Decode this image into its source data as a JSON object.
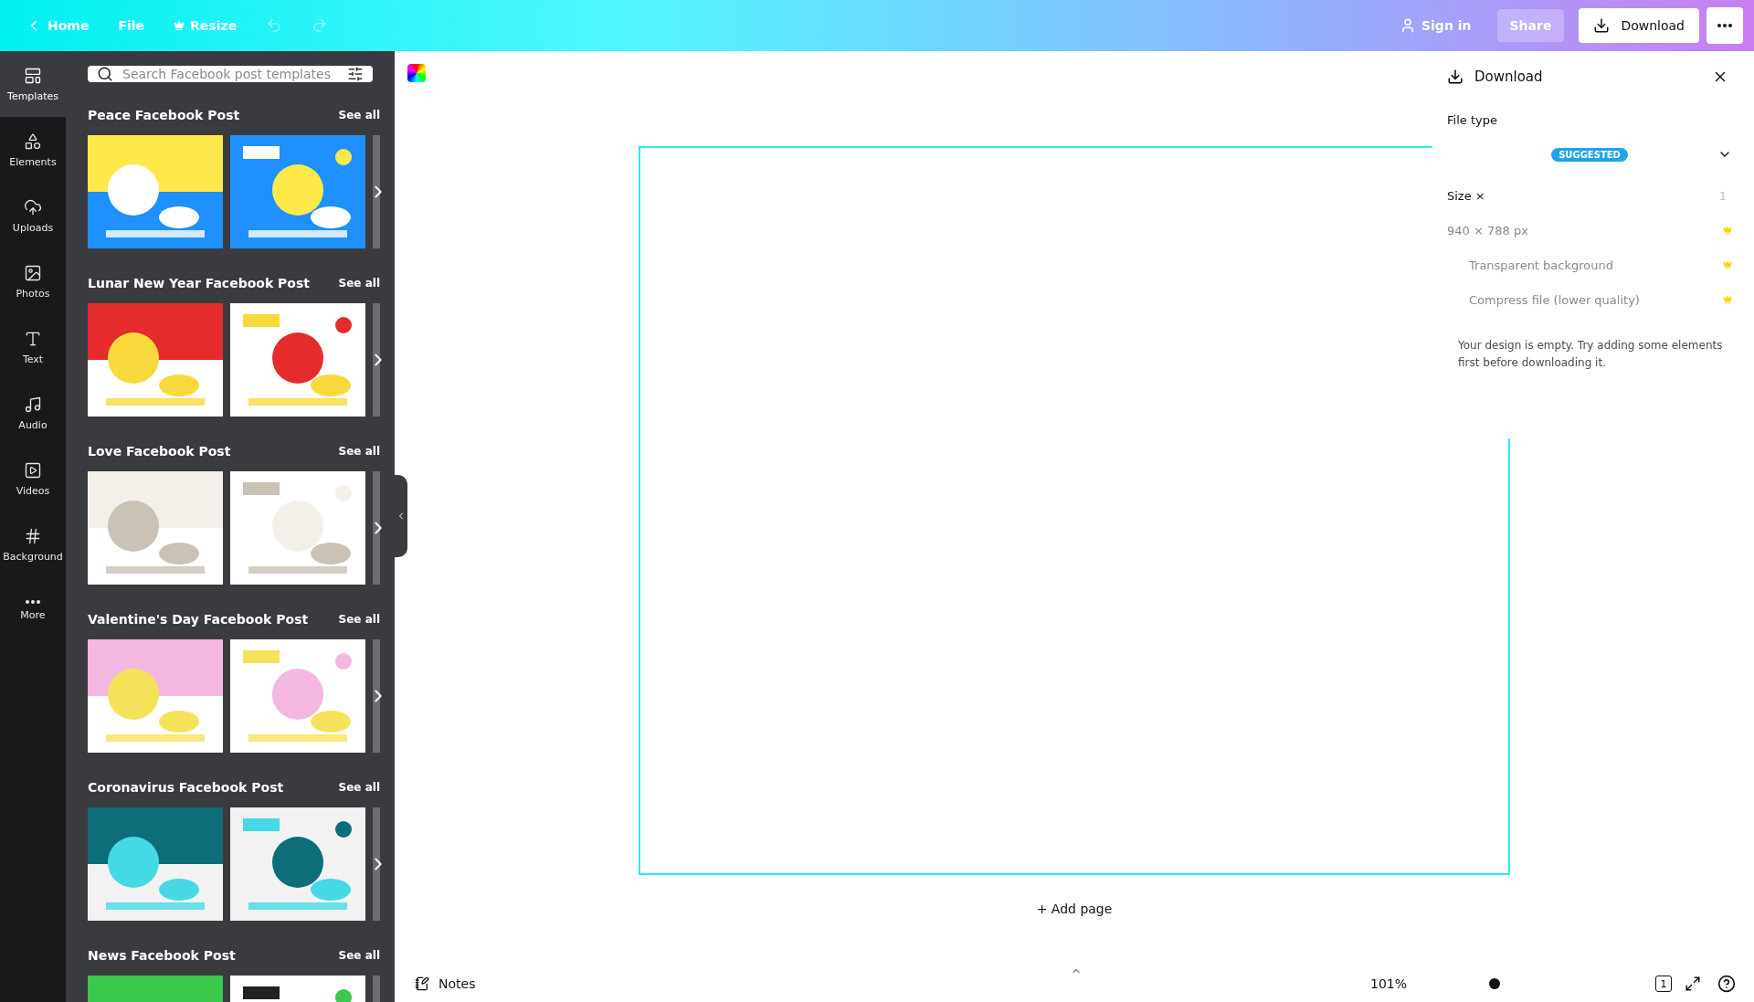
{
  "topbar": {
    "home": "Home",
    "file": "File",
    "resize": "Resize",
    "undo": {
      "disabled": true
    },
    "redo": {
      "disabled": true
    },
    "sign_in": "Sign in",
    "share": "Share",
    "download": "Download"
  },
  "rail": [
    {
      "label": "Templates",
      "selected": true
    },
    {
      "label": "Elements",
      "selected": false
    },
    {
      "label": "Uploads",
      "selected": false
    },
    {
      "label": "Photos",
      "selected": false
    },
    {
      "label": "Text",
      "selected": false
    },
    {
      "label": "Audio",
      "selected": false
    },
    {
      "label": "Videos",
      "selected": false
    },
    {
      "label": "Background",
      "selected": false
    },
    {
      "label": "More",
      "selected": false
    }
  ],
  "search": {
    "placeholder": "Search Facebook post templates"
  },
  "sections": [
    {
      "title": "Peace Facebook Post",
      "see_all": "See all"
    },
    {
      "title": "Lunar New Year Facebook Post",
      "see_all": "See all"
    },
    {
      "title": "Love Facebook Post",
      "see_all": "See all"
    },
    {
      "title": "Valentine's Day Facebook Post",
      "see_all": "See all"
    },
    {
      "title": "Coronavirus Facebook Post",
      "see_all": "See all"
    },
    {
      "title": "News Facebook Post",
      "see_all": "See all"
    }
  ],
  "canvas": {
    "add_page": "+ Add page"
  },
  "download_panel": {
    "title": "Download",
    "file_type_label": "File type",
    "badge": "SUGGESTED",
    "size_label": "Size ×",
    "size_value": "1",
    "dimensions": "940 × 788 px",
    "options": [
      {
        "label": "Transparent background"
      },
      {
        "label": "Compress file (lower quality)"
      }
    ],
    "message": "Your design is empty. Try adding some elements first before downloading it."
  },
  "bottombar": {
    "notes": "Notes",
    "zoom": "101%",
    "page_count": "1"
  }
}
